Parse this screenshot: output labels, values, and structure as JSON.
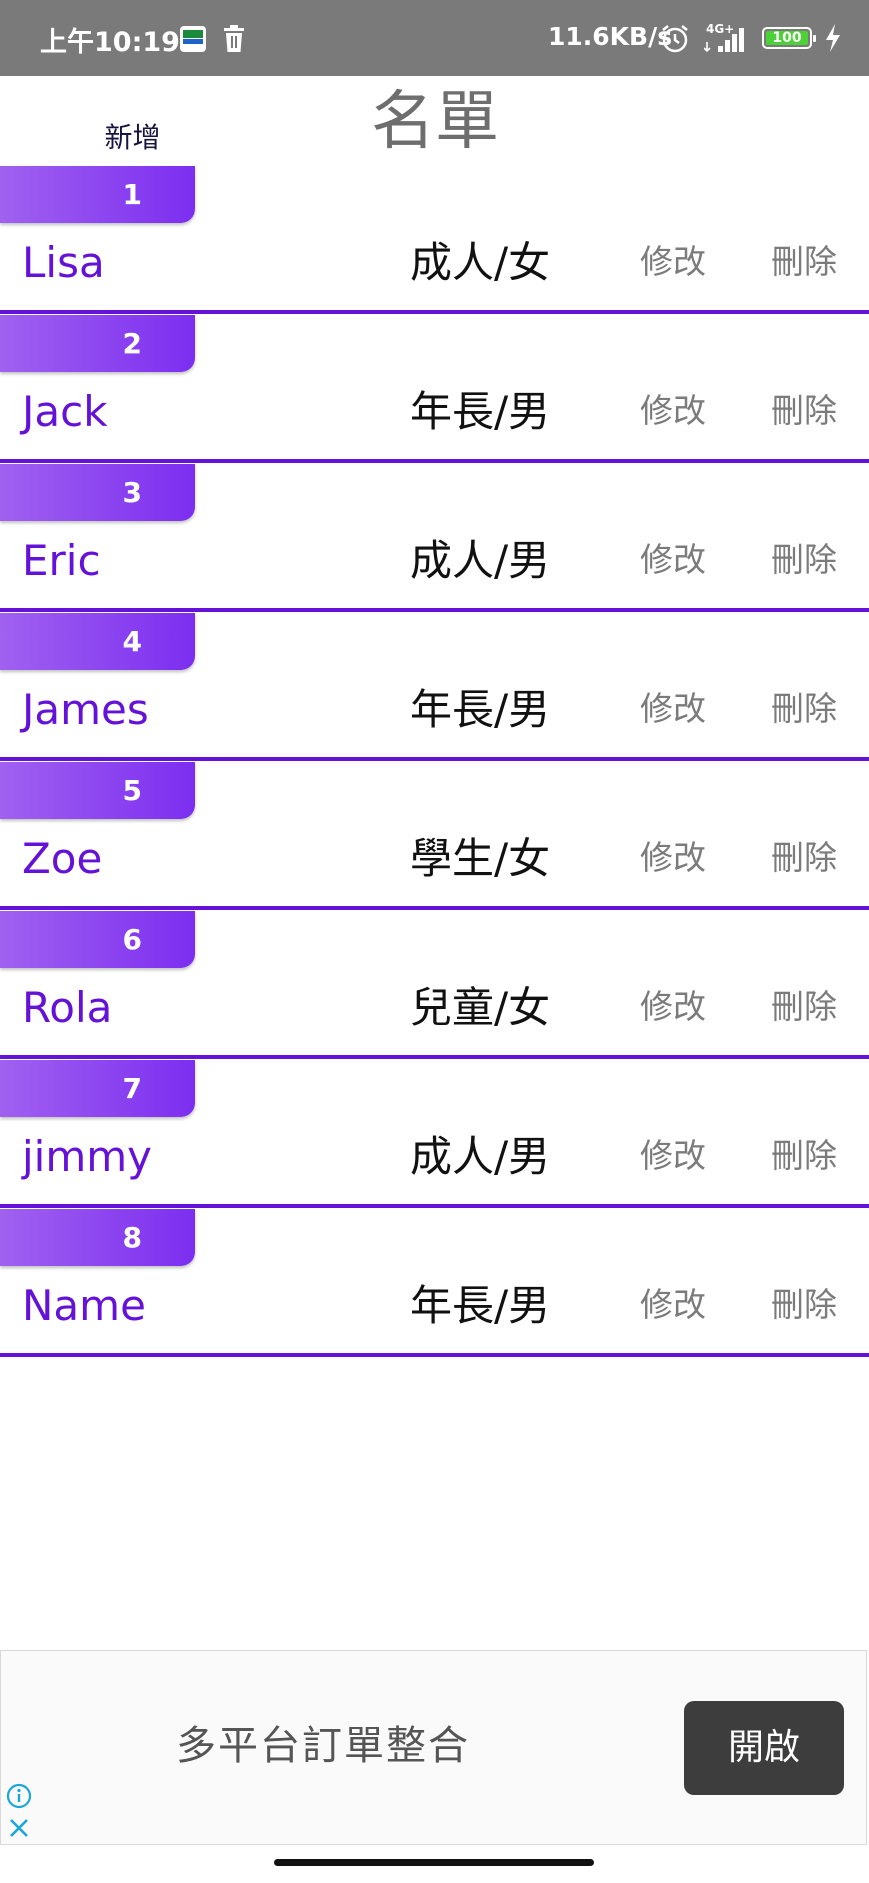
{
  "status_bar": {
    "time": "上午10:19",
    "network_speed": "11.6KB/s",
    "network_type": "4G+",
    "battery": "100",
    "icons": [
      "app-icon",
      "trash-icon",
      "alarm-icon",
      "signal-icon",
      "battery-icon",
      "charging-bolt-icon"
    ]
  },
  "header": {
    "add_label": "新增",
    "title": "名單"
  },
  "list": {
    "items": [
      {
        "index": "1",
        "name": "Lisa",
        "category": "成人/女",
        "edit_label": "修改",
        "delete_label": "刪除"
      },
      {
        "index": "2",
        "name": "Jack",
        "category": "年長/男",
        "edit_label": "修改",
        "delete_label": "刪除"
      },
      {
        "index": "3",
        "name": "Eric",
        "category": "成人/男",
        "edit_label": "修改",
        "delete_label": "刪除"
      },
      {
        "index": "4",
        "name": "James",
        "category": "年長/男",
        "edit_label": "修改",
        "delete_label": "刪除"
      },
      {
        "index": "5",
        "name": "Zoe",
        "category": "學生/女",
        "edit_label": "修改",
        "delete_label": "刪除"
      },
      {
        "index": "6",
        "name": "Rola",
        "category": "兒童/女",
        "edit_label": "修改",
        "delete_label": "刪除"
      },
      {
        "index": "7",
        "name": "jimmy",
        "category": "成人/男",
        "edit_label": "修改",
        "delete_label": "刪除"
      },
      {
        "index": "8",
        "name": "Name",
        "category": "年長/男",
        "edit_label": "修改",
        "delete_label": "刪除"
      }
    ]
  },
  "ad": {
    "text": "多平台訂單整合",
    "button_label": "開啟",
    "icons": [
      "info-icon",
      "close-icon"
    ]
  },
  "colors": {
    "accent": "#6512d8",
    "tab_gradient_start": "#a061f0",
    "tab_gradient_end": "#7c2ef0",
    "status_bar": "#7a7a7a",
    "ad_button": "#3d3d3d"
  }
}
